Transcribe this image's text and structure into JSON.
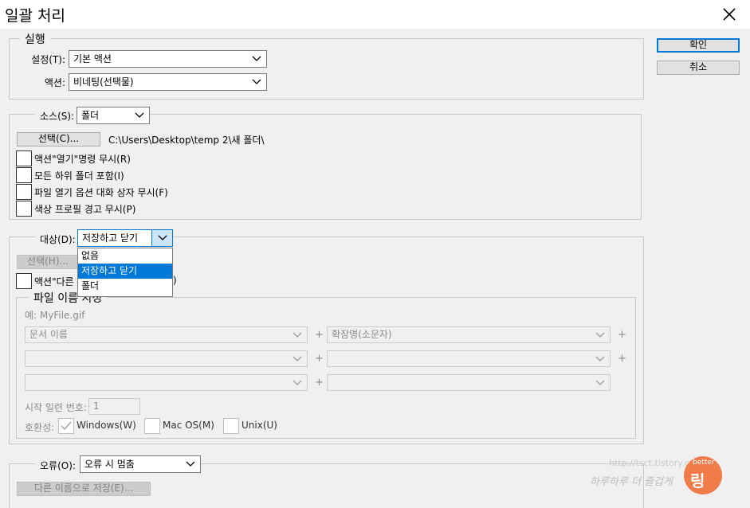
{
  "window": {
    "title": "일괄 처리"
  },
  "buttons": {
    "ok": "확인",
    "cancel": "취소"
  },
  "execute": {
    "legend": "실행",
    "set_label": "설정(T):",
    "set_value": "기본 액션",
    "action_label": "액션:",
    "action_value": "비네팅(선택물)"
  },
  "source": {
    "label": "소스(S):",
    "value": "폴더",
    "choose_button": "선택(C)...",
    "path": "C:\\Users\\Desktop\\temp 2\\새 폴더\\",
    "checkboxes": [
      "액션\"열기\"명령 무시(R)",
      "모든 하위 폴더 포함(I)",
      "파일 열기 옵션 대화 상자 무시(F)",
      "색상 프로필 경고 무시(P)"
    ]
  },
  "destination": {
    "label": "대상(D):",
    "value": "저장하고 닫기",
    "choose_button": "선택(H)...",
    "override_check_start": "액션\"다른 이",
    "override_check_end": ")",
    "dropdown_options": [
      "없음",
      "저장하고 닫기",
      "폴더"
    ],
    "selected_option": "저장하고 닫기"
  },
  "file_naming": {
    "legend": "파일 이름 지정",
    "example": "예: MyFile.gif",
    "rows": [
      {
        "left": "문서 이름",
        "right": "확장명(소문자)"
      },
      {
        "left": "",
        "right": ""
      },
      {
        "left": "",
        "right": ""
      }
    ],
    "plus": "+",
    "serial_label": "시작 일련 번호:",
    "serial_value": "1",
    "compat_label": "호환성:",
    "compat": [
      "Windows(W)",
      "Mac OS(M)",
      "Unix(U)"
    ]
  },
  "errors": {
    "label": "오류(O):",
    "value": "오류 시 멈춤",
    "save_as_button": "다른 이름으로 저장(E)..."
  },
  "watermark": {
    "url": "http://tsct.tistory.com",
    "tagline": "하루하루 더 즐겁게",
    "brand": "better",
    "logo": "링"
  }
}
